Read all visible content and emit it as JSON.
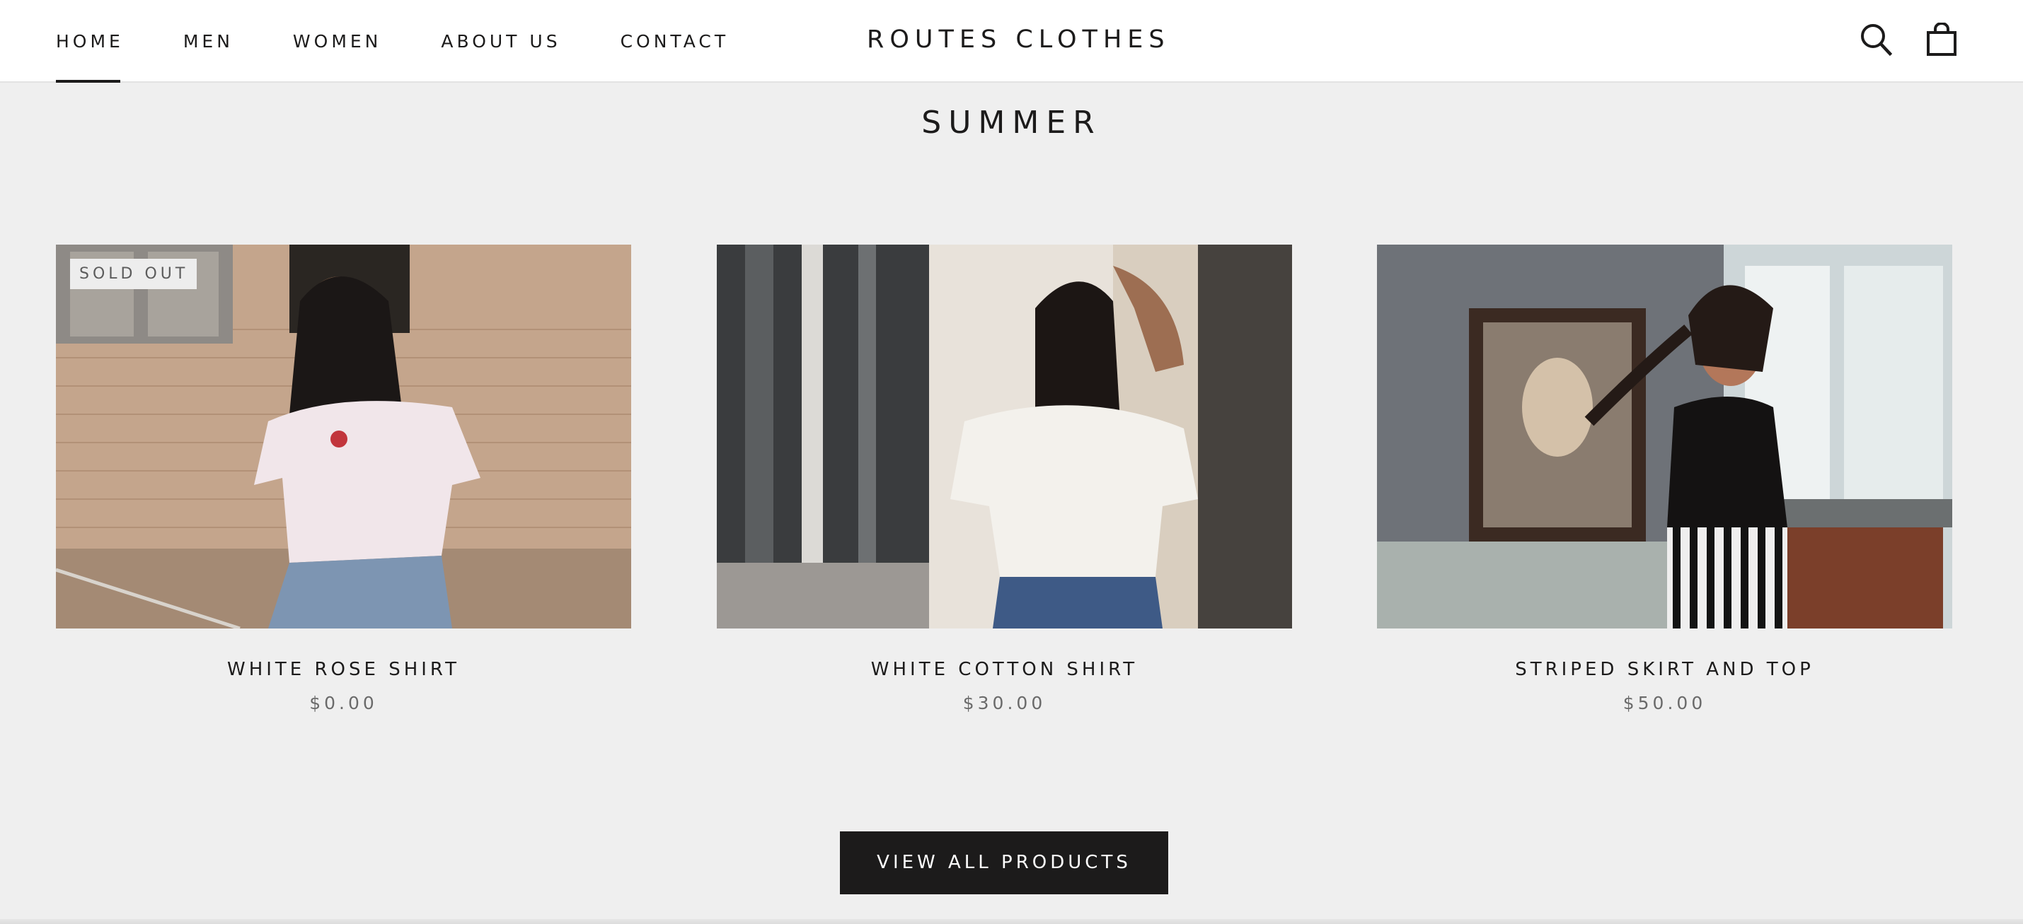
{
  "header": {
    "nav": [
      {
        "label": "HOME",
        "active": true
      },
      {
        "label": "MEN",
        "active": false
      },
      {
        "label": "WOMEN",
        "active": false
      },
      {
        "label": "ABOUT US",
        "active": false
      },
      {
        "label": "CONTACT",
        "active": false
      }
    ],
    "logo": "ROUTES CLOTHES",
    "icons": [
      "search-icon",
      "shopping-bag-icon"
    ]
  },
  "collection": {
    "title": "SUMMER"
  },
  "products": [
    {
      "title": "WHITE ROSE SHIRT",
      "price": "$0.00",
      "badge": "SOLD OUT"
    },
    {
      "title": "WHITE COTTON SHIRT",
      "price": "$30.00",
      "badge": ""
    },
    {
      "title": "STRIPED SKIRT AND TOP",
      "price": "$50.00",
      "badge": ""
    }
  ],
  "cta": {
    "label": "VIEW ALL PRODUCTS"
  },
  "colors": {
    "page_background": "#efefef",
    "header_background": "#ffffff",
    "text": "#1c1b1b",
    "price_text": "#6a6a6a",
    "button_background": "#1c1b1b",
    "button_text": "#ffffff"
  }
}
